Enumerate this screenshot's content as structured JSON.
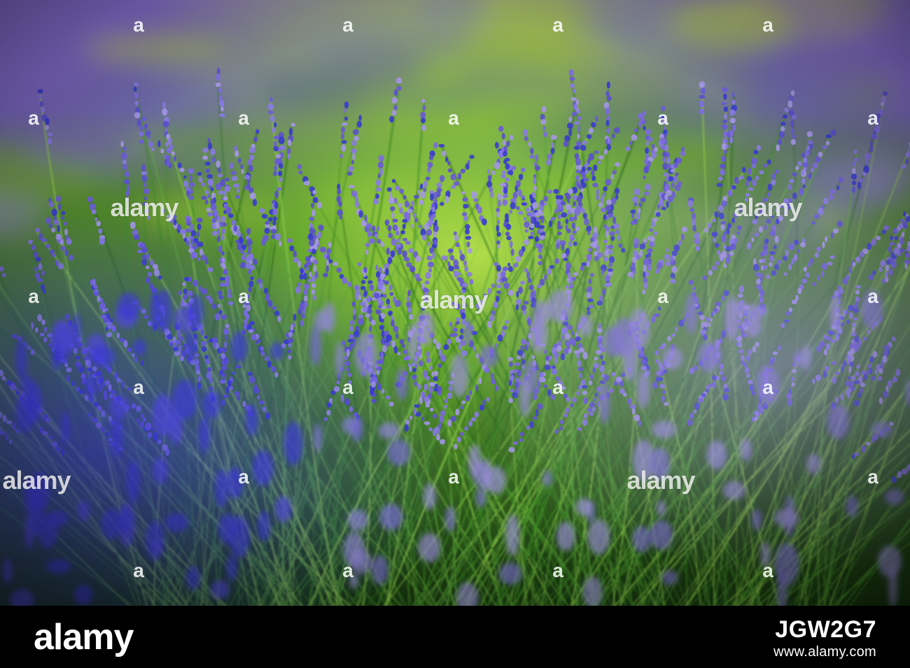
{
  "photo": {
    "subject": "lavender-field",
    "colors": {
      "sky_violet": "#8b6fd6",
      "lavender": "#7d6ae0",
      "deep_blue": "#3a3ad0",
      "stem_green": "#3f8a25",
      "glow_green": "#b8e04a",
      "shadow": "#0f2a0a"
    }
  },
  "watermark": {
    "text": "alamy",
    "mark": "a"
  },
  "footer": {
    "brand": "alamy",
    "image_code": "JGW2G7",
    "site": "www.alamy.com",
    "background": "#000000",
    "text_color": "#ffffff"
  }
}
